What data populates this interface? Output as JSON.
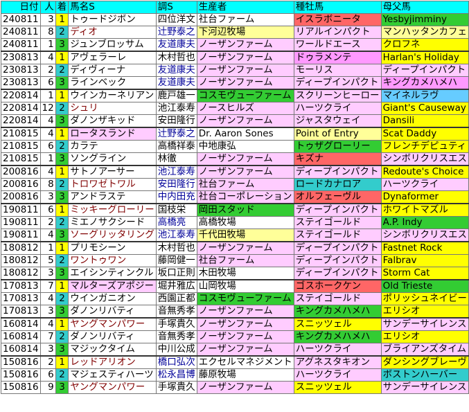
{
  "headers": [
    "日付",
    "人",
    "着",
    "馬名S",
    "調S",
    "生産者",
    "種牡馬",
    "母父馬"
  ],
  "header_colors": [
    "#00ffff",
    "#00ffff",
    "#00ffff",
    "#00ffff",
    "#00ffff",
    "#00ffff",
    "#00ffff",
    "#00ffff"
  ],
  "rows": [
    {
      "date": "240811",
      "ninki": "3",
      "chaku": "1",
      "horse": "トゥードジボン",
      "jockey": "四位洋文",
      "breeder": "社台ファーム",
      "sire": "イスラボニータ",
      "bms": "Yesbyjimminy",
      "cc": "#ffff00",
      "hc": "#ffffff",
      "hf": "#000000",
      "jc": "#ffffff",
      "jf": "#000000",
      "bc": "#ffffff",
      "sc": "#ff6666",
      "mc": "#33cc33"
    },
    {
      "date": "240811",
      "ninki": "8",
      "chaku": "2",
      "horse": "ディオ",
      "jockey": "辻野泰之",
      "breeder": "下河辺牧場",
      "sire": "リアルインパクト",
      "bms": "マンハッタンカフェ",
      "cc": "#33cccc",
      "hc": "#ffffff",
      "hf": "#800000",
      "jc": "#ffffff",
      "jf": "#000099",
      "bc": "#ffff99",
      "sc": "#ffccff",
      "mc": "#ffff99"
    },
    {
      "date": "240811",
      "ninki": "1",
      "chaku": "3",
      "horse": "ジュンブロッサム",
      "jockey": "友道康夫",
      "breeder": "ノーザンファーム",
      "sire": "ワールドエース",
      "bms": "クロフネ",
      "cc": "#33cc33",
      "hc": "#ffffff",
      "hf": "#000000",
      "jc": "#ffffff",
      "jf": "#000099",
      "bc": "#ffccff",
      "sc": "#ffccff",
      "mc": "#ffff00"
    },
    {
      "date": "230813",
      "ninki": "4",
      "chaku": "1",
      "horse": "アヴェラーレ",
      "jockey": "木村哲也",
      "breeder": "ノーザンファーム",
      "sire": "ドゥラメンテ",
      "bms": "Harlan's Holiday",
      "cc": "#ffff00",
      "hc": "#ffffff",
      "hf": "#000000",
      "jc": "#ffffff",
      "jf": "#000000",
      "bc": "#ffccff",
      "sc": "#ff99ff",
      "mc": "#ffff00"
    },
    {
      "date": "230813",
      "ninki": "2",
      "chaku": "2",
      "horse": "ディヴィーナ",
      "jockey": "友道康夫",
      "breeder": "ノーザンファーム",
      "sire": "モーリス",
      "bms": "ディープインパクト",
      "cc": "#33cccc",
      "hc": "#ffffff",
      "hf": "#000000",
      "jc": "#ffffff",
      "jf": "#000099",
      "bc": "#ffccff",
      "sc": "#ffccff",
      "mc": "#ffccff"
    },
    {
      "date": "230813",
      "ninki": "6",
      "chaku": "3",
      "horse": "ラインベック",
      "jockey": "友道康夫",
      "breeder": "ノーザンファーム",
      "sire": "ディープインパクト",
      "bms": "キングカメハメハ",
      "cc": "#33cc33",
      "hc": "#ffffff",
      "hf": "#000000",
      "jc": "#ffffff",
      "jf": "#000099",
      "bc": "#ffccff",
      "sc": "#ffccff",
      "mc": "#ff99ff"
    },
    {
      "date": "220814",
      "ninki": "1",
      "chaku": "1",
      "horse": "ウインカーネリアン",
      "jockey": "鹿戸雄一",
      "breeder": "コスモヴューファーム",
      "sire": "スクリーンヒーロー",
      "bms": "マイネルラヴ",
      "cc": "#ffff00",
      "hc": "#ffffff",
      "hf": "#000000",
      "jc": "#ffffff",
      "jf": "#000000",
      "bc": "#33cc33",
      "sc": "#ffccff",
      "mc": "#66ccff"
    },
    {
      "date": "220814",
      "ninki": "12",
      "chaku": "2",
      "horse": "シュリ",
      "jockey": "池江泰寿",
      "breeder": "ノースヒルズ",
      "sire": "ハーツクライ",
      "bms": "Giant's Causeway",
      "cc": "#33cccc",
      "hc": "#ffffff",
      "hf": "#800000",
      "jc": "#ffffff",
      "jf": "#000000",
      "bc": "#ffccff",
      "sc": "#ffccff",
      "mc": "#ffff00"
    },
    {
      "date": "220814",
      "ninki": "4",
      "chaku": "3",
      "horse": "ダノンザキッド",
      "jockey": "安田隆行",
      "breeder": "ノーザンファーム",
      "sire": "ジャスタウェイ",
      "bms": "Dansili",
      "cc": "#33cc33",
      "hc": "#ffffff",
      "hf": "#000000",
      "jc": "#ffffff",
      "jf": "#000000",
      "bc": "#ffccff",
      "sc": "#ffccff",
      "mc": "#ffff00"
    },
    {
      "date": "210815",
      "ninki": "4",
      "chaku": "1",
      "horse": "ロータスランド",
      "jockey": "辻野泰之",
      "breeder": "Dr. Aaron Sones",
      "sire": "Point of Entry",
      "bms": "Scat Daddy",
      "cc": "#ffff00",
      "hc": "#ffccff",
      "hf": "#000000",
      "jc": "#ffffff",
      "jf": "#000099",
      "bc": "#ffffff",
      "sc": "#ffff99",
      "mc": "#ffff00"
    },
    {
      "date": "210815",
      "ninki": "6",
      "chaku": "2",
      "horse": "カラテ",
      "jockey": "高橋祥泰",
      "breeder": "中地康弘",
      "sire": "トゥザグローリー",
      "bms": "フレンチデピュティ",
      "cc": "#33cccc",
      "hc": "#ffffff",
      "hf": "#000000",
      "jc": "#ffffff",
      "jf": "#000000",
      "bc": "#ffffff",
      "sc": "#33cc33",
      "mc": "#ffff00"
    },
    {
      "date": "210815",
      "ninki": "1",
      "chaku": "3",
      "horse": "ソングライン",
      "jockey": "林徹",
      "breeder": "ノーザンファーム",
      "sire": "キズナ",
      "bms": "シンボリクリスエス",
      "cc": "#33cc33",
      "hc": "#ffffff",
      "hf": "#000000",
      "jc": "#ffffff",
      "jf": "#000000",
      "bc": "#ffccff",
      "sc": "#ff6666",
      "mc": "#ffccff"
    },
    {
      "date": "200816",
      "ninki": "4",
      "chaku": "1",
      "horse": "サトノアーサー",
      "jockey": "池江泰寿",
      "breeder": "ノーザンファーム",
      "sire": "ディープインパクト",
      "bms": "Redoute's Choice",
      "cc": "#ffff00",
      "hc": "#ffffff",
      "hf": "#000000",
      "jc": "#ffffff",
      "jf": "#000099",
      "bc": "#ffccff",
      "sc": "#ffccff",
      "mc": "#ffff00"
    },
    {
      "date": "200816",
      "ninki": "8",
      "chaku": "2",
      "horse": "トロワゼトワル",
      "jockey": "安田隆行",
      "breeder": "社台ファーム",
      "sire": "ロードカナロア",
      "bms": "ハーツクライ",
      "cc": "#33cccc",
      "hc": "#ffffff",
      "hf": "#800000",
      "jc": "#ffffff",
      "jf": "#000099",
      "bc": "#ffccff",
      "sc": "#33cccc",
      "mc": "#ffccff"
    },
    {
      "date": "200816",
      "ninki": "3",
      "chaku": "3",
      "horse": "アンドラステ",
      "jockey": "中内田充",
      "breeder": "社台コーポレーション",
      "sire": "オルフェーヴル",
      "bms": "Dynaformer",
      "cc": "#33cc33",
      "hc": "#ffffff",
      "hf": "#000000",
      "jc": "#ffffff",
      "jf": "#000099",
      "bc": "#ffccff",
      "sc": "#ff6666",
      "mc": "#ffff00"
    },
    {
      "date": "190811",
      "ninki": "6",
      "chaku": "1",
      "horse": "ミッキーグローリー",
      "jockey": "国枝栄",
      "breeder": "岡田スタッド",
      "sire": "ディープインパクト",
      "bms": "ホワイトマズル",
      "cc": "#ffff00",
      "hc": "#ffffff",
      "hf": "#800000",
      "jc": "#ffffff",
      "jf": "#000000",
      "bc": "#33cc33",
      "sc": "#ffccff",
      "mc": "#ffff00"
    },
    {
      "date": "190811",
      "ninki": "2",
      "chaku": "2",
      "horse": "ミエノサクシード",
      "jockey": "高橋亮",
      "breeder": "高橋牧場",
      "sire": "ステイゴールド",
      "bms": "A.P. Indy",
      "cc": "#33cccc",
      "hc": "#ffffff",
      "hf": "#000000",
      "jc": "#ffffff",
      "jf": "#000099",
      "bc": "#ffffff",
      "sc": "#ffccff",
      "mc": "#33cc33"
    },
    {
      "date": "190811",
      "ninki": "4",
      "chaku": "3",
      "horse": "ソーグリッタリング",
      "jockey": "池江泰寿",
      "breeder": "千代田牧場",
      "sire": "ステイゴールド",
      "bms": "シンボリクリスエス",
      "cc": "#33cc33",
      "hc": "#ffffff",
      "hf": "#800000",
      "jc": "#ffffff",
      "jf": "#000099",
      "bc": "#ffff99",
      "sc": "#ffccff",
      "mc": "#ffccff"
    },
    {
      "date": "180812",
      "ninki": "1",
      "chaku": "1",
      "horse": "プリモシーン",
      "jockey": "木村哲也",
      "breeder": "ノーザンファーム",
      "sire": "ディープインパクト",
      "bms": "Fastnet Rock",
      "cc": "#ffff00",
      "hc": "#ffffff",
      "hf": "#000000",
      "jc": "#ffffff",
      "jf": "#000000",
      "bc": "#ffccff",
      "sc": "#ffccff",
      "mc": "#ffff00"
    },
    {
      "date": "180812",
      "ninki": "5",
      "chaku": "2",
      "horse": "ワントゥワン",
      "jockey": "藤岡健一",
      "breeder": "社台ファーム",
      "sire": "ディープインパクト",
      "bms": "Falbrav",
      "cc": "#33cccc",
      "hc": "#ffffff",
      "hf": "#800000",
      "jc": "#ffffff",
      "jf": "#000000",
      "bc": "#ffccff",
      "sc": "#ffccff",
      "mc": "#ffff00"
    },
    {
      "date": "180812",
      "ninki": "3",
      "chaku": "3",
      "horse": "エイシンティンクル",
      "jockey": "坂口正則",
      "breeder": "木田牧場",
      "sire": "ディープインパクト",
      "bms": "Storm Cat",
      "cc": "#33cc33",
      "hc": "#ffffff",
      "hf": "#000000",
      "jc": "#ffffff",
      "jf": "#000000",
      "bc": "#ffffff",
      "sc": "#ffccff",
      "mc": "#ffff00"
    },
    {
      "date": "170813",
      "ninki": "7",
      "chaku": "1",
      "horse": "マルターズアポジー",
      "jockey": "堀井雅広",
      "breeder": "山岡牧場",
      "sire": "ゴスホークケン",
      "bms": "Old Trieste",
      "cc": "#ffff00",
      "hc": "#ffccff",
      "hf": "#000000",
      "jc": "#ffffff",
      "jf": "#000000",
      "bc": "#ffffff",
      "sc": "#ff6666",
      "mc": "#33cc33"
    },
    {
      "date": "170813",
      "ninki": "4",
      "chaku": "2",
      "horse": "ウインガニオン",
      "jockey": "西園正都",
      "breeder": "コスモヴューファーム",
      "sire": "ステイゴールド",
      "bms": "ポリッシュネイビー",
      "cc": "#33cccc",
      "hc": "#ffffff",
      "hf": "#000000",
      "jc": "#ffffff",
      "jf": "#000000",
      "bc": "#33cc33",
      "sc": "#ffccff",
      "mc": "#ffff00"
    },
    {
      "date": "170813",
      "ninki": "3",
      "chaku": "3",
      "horse": "ダノンリバティ",
      "jockey": "音無秀孝",
      "breeder": "ノーザンファーム",
      "sire": "キングカメハメハ",
      "bms": "エリシオ",
      "cc": "#33cc33",
      "hc": "#ffffff",
      "hf": "#000000",
      "jc": "#ffffff",
      "jf": "#000000",
      "bc": "#ffccff",
      "sc": "#33cc33",
      "mc": "#ffff00"
    },
    {
      "date": "160814",
      "ninki": "4",
      "chaku": "1",
      "horse": "ヤングマンパワー",
      "jockey": "手塚貴久",
      "breeder": "ノーザンファーム",
      "sire": "スニッツェル",
      "bms": "サンデーサイレンス",
      "cc": "#ffff00",
      "hc": "#ffffff",
      "hf": "#800000",
      "jc": "#ffffff",
      "jf": "#000000",
      "bc": "#ffccff",
      "sc": "#ffff00",
      "mc": "#ffccff"
    },
    {
      "date": "160814",
      "ninki": "7",
      "chaku": "2",
      "horse": "ダノンリバティ",
      "jockey": "音無秀孝",
      "breeder": "ノーザンファーム",
      "sire": "キングカメハメハ",
      "bms": "エリシオ",
      "cc": "#33cccc",
      "hc": "#ffffff",
      "hf": "#000000",
      "jc": "#ffffff",
      "jf": "#000000",
      "bc": "#ffccff",
      "sc": "#33cc33",
      "mc": "#ffff00"
    },
    {
      "date": "160814",
      "ninki": "3",
      "chaku": "3",
      "horse": "マジックタイム",
      "jockey": "中川公成",
      "breeder": "ノーザンファーム",
      "sire": "ハーツクライ",
      "bms": "ブライアンズタイム",
      "cc": "#33cc33",
      "hc": "#ffffff",
      "hf": "#000000",
      "jc": "#ffffff",
      "jf": "#000000",
      "bc": "#ffccff",
      "sc": "#ffccff",
      "mc": "#ffccff"
    },
    {
      "date": "150816",
      "ninki": "2",
      "chaku": "1",
      "horse": "レッドアリオン",
      "jockey": "橋口弘次",
      "breeder": "エクセルマネジメント",
      "sire": "アグネスタキオン",
      "bms": "ダンシングブレーヴ",
      "cc": "#ffff00",
      "hc": "#ffffff",
      "hf": "#800000",
      "jc": "#ffffff",
      "jf": "#000099",
      "bc": "#ffffff",
      "sc": "#ffccff",
      "mc": "#ffff00"
    },
    {
      "date": "150816",
      "ninki": "6",
      "chaku": "2",
      "horse": "マジェスティハーツ",
      "jockey": "松永昌博",
      "breeder": "藤原牧場",
      "sire": "ハーツクライ",
      "bms": "ボストンハーバー",
      "cc": "#33cccc",
      "hc": "#ffffff",
      "hf": "#000000",
      "jc": "#ffffff",
      "jf": "#000099",
      "bc": "#ffffff",
      "sc": "#ffccff",
      "mc": "#33cccc"
    },
    {
      "date": "150816",
      "ninki": "9",
      "chaku": "3",
      "horse": "ヤングマンパワー",
      "jockey": "手塚貴久",
      "breeder": "ノーザンファーム",
      "sire": "スニッツェル",
      "bms": "サンデーサイレンス",
      "cc": "#33cc33",
      "hc": "#ffffff",
      "hf": "#800000",
      "jc": "#ffffff",
      "jf": "#000000",
      "bc": "#ffccff",
      "sc": "#ffff00",
      "mc": "#ffccff"
    }
  ]
}
